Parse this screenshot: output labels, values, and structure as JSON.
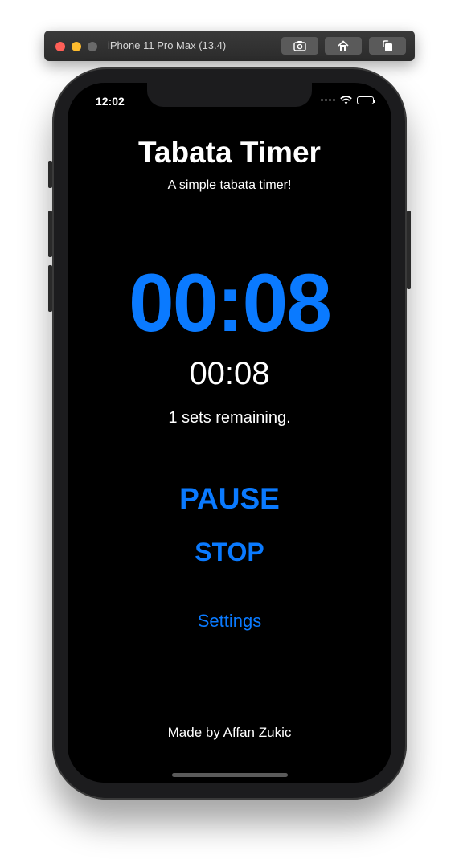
{
  "simulator": {
    "title": "iPhone 11 Pro Max (13.4)",
    "buttons": [
      "screenshot-icon",
      "home-icon",
      "rotate-icon"
    ]
  },
  "status_bar": {
    "time": "12:02"
  },
  "app": {
    "title": "Tabata Timer",
    "subtitle": "A simple tabata timer!",
    "main_timer": "00:08",
    "secondary_timer": "00:08",
    "sets_remaining": "1 sets remaining.",
    "pause_label": "PAUSE",
    "stop_label": "STOP",
    "settings_label": "Settings",
    "footer": "Made by Affan Zukic"
  },
  "colors": {
    "accent": "#0a7aff",
    "background": "#000000",
    "text": "#ffffff"
  }
}
